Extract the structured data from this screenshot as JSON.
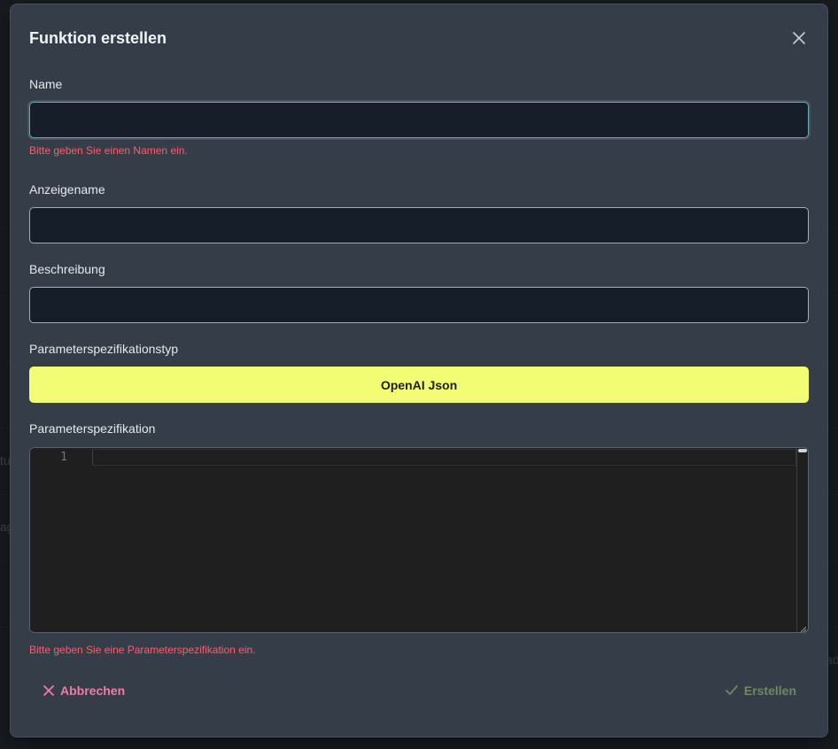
{
  "dialog": {
    "title": "Funktion erstellen",
    "close_icon": "close-icon"
  },
  "form": {
    "name": {
      "label": "Name",
      "value": "",
      "error": "Bitte geben Sie einen Namen ein."
    },
    "display_name": {
      "label": "Anzeigename",
      "value": ""
    },
    "description": {
      "label": "Beschreibung",
      "value": ""
    },
    "param_spec_type": {
      "label": "Parameterspezifikationstyp",
      "selected": "OpenAI Json"
    },
    "param_spec": {
      "label": "Parameterspezifikation",
      "line_numbers": [
        "1"
      ],
      "error": "Bitte geben Sie eine Parameterspezifikation ein."
    }
  },
  "footer": {
    "cancel_label": "Abbrechen",
    "create_label": "Erstellen"
  },
  "background": {
    "fragments": [
      "tu",
      "ag",
      "ad"
    ]
  },
  "colors": {
    "accent_yellow": "#f2fd74",
    "error_red": "#ff5d6c",
    "cancel_pink": "#f27ca6",
    "create_green_disabled": "#6e8a5e",
    "dialog_bg": "#343d48",
    "input_bg": "#161e2a"
  }
}
